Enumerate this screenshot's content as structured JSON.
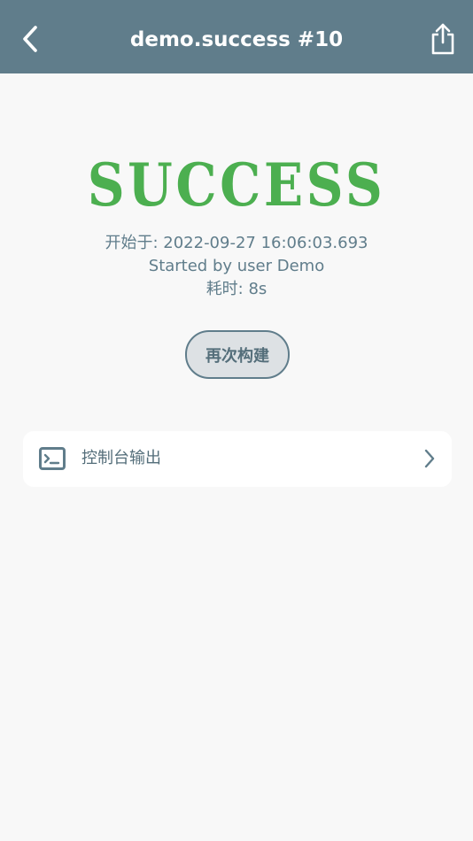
{
  "header": {
    "title": "demo.success #10",
    "back_icon": "chevron-left-icon",
    "share_icon": "share-icon"
  },
  "status": {
    "result": "SUCCESS",
    "result_color": "#4caf50",
    "started_at": "开始于: 2022-09-27 16:06:03.693",
    "started_by": "Started by user Demo",
    "duration": "耗时: 8s"
  },
  "actions": {
    "rebuild_label": "再次构建"
  },
  "sections": {
    "console_label": "控制台输出",
    "console_icon": "terminal-icon"
  },
  "colors": {
    "header_bg": "#607d8b",
    "page_bg": "#f8f8f8",
    "text_secondary": "#607d8b",
    "success": "#4caf50"
  }
}
